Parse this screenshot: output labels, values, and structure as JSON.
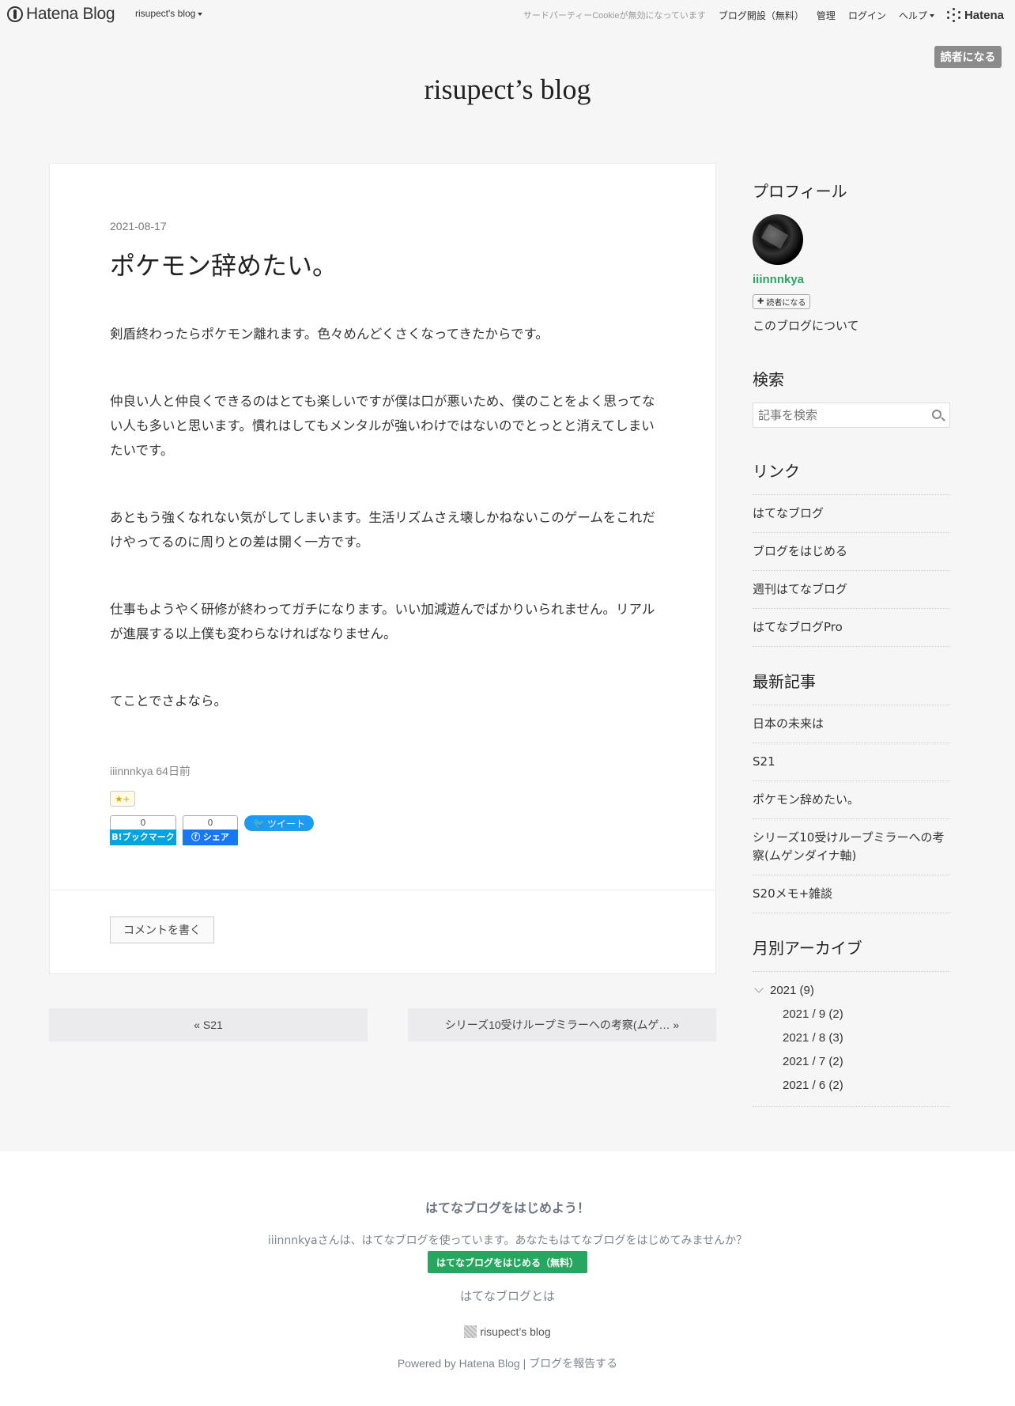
{
  "header": {
    "logo_text": "Hatena Blog",
    "blog_menu": "risupect's blog",
    "cookie_notice": "サードパーティーCookieが無効になっています",
    "nav": [
      "ブログ開設（無料）",
      "管理",
      "ログイン",
      "ヘルプ"
    ],
    "hatena_brand": "Hatena"
  },
  "subscribe_label": "読者になる",
  "blog_title": "risupect’s blog",
  "entry": {
    "date": "2021-08-17",
    "title": "ポケモン辞めたい。",
    "paragraphs": [
      "剣盾終わったらポケモン離れます。色々めんどくさくなってきたからです。",
      "仲良い人と仲良くできるのはとても楽しいですが僕は口が悪いため、僕のことをよく思ってない人も多いと思います。慣れはしてもメンタルが強いわけではないのでとっとと消えてしまいたいです。",
      "あともう強くなれない気がしてしまいます。生活リズムさえ壊しかねないこのゲームをこれだけやってるのに周りとの差は開く一方です。",
      "仕事もようやく研修が終わってガチになります。いい加減遊んでばかりいられません。リアルが進展する以上僕も変わらなければなりません。",
      "てことでさよなら。"
    ],
    "author_line": "iiinnnkya 64日前",
    "star_label": "★+",
    "bookmark_count": "0",
    "bookmark_label": "B!ブックマーク",
    "share_count": "0",
    "share_label": "シェア",
    "tweet_label": "ツイート",
    "comment_label": "コメントを書く"
  },
  "pager": {
    "prev": "« S21",
    "next": "シリーズ10受けループミラーへの考察(ムゲ… »"
  },
  "sidebar": {
    "profile": {
      "heading": "プロフィール",
      "name": "iiinnnkya",
      "follow_label": "読者になる",
      "about": "このブログについて"
    },
    "search": {
      "heading": "検索",
      "placeholder": "記事を検索"
    },
    "links": {
      "heading": "リンク",
      "items": [
        "はてなブログ",
        "ブログをはじめる",
        "週刊はてなブログ",
        "はてなブログPro"
      ]
    },
    "recent": {
      "heading": "最新記事",
      "items": [
        "日本の未来は",
        "S21",
        "ポケモン辞めたい。",
        "シリーズ10受けループミラーへの考察(ムゲンダイナ軸)",
        "S20メモ+雑談"
      ]
    },
    "archive": {
      "heading": "月別アーカイブ",
      "year": "2021 (9)",
      "months": [
        "2021 / 9 (2)",
        "2021 / 8 (3)",
        "2021 / 7 (2)",
        "2021 / 6 (2)"
      ]
    }
  },
  "footer": {
    "title": "はてなブログをはじめよう！",
    "desc": "iiinnnkyaさんは、はてなブログを使っています。あなたもはてなブログをはじめてみませんか？",
    "start_button": "はてなブログをはじめる（無料）",
    "about": "はてなブログとは",
    "blog_name": "risupect’s blog",
    "powered": "Powered by Hatena Blog",
    "report": "ブログを報告する"
  }
}
